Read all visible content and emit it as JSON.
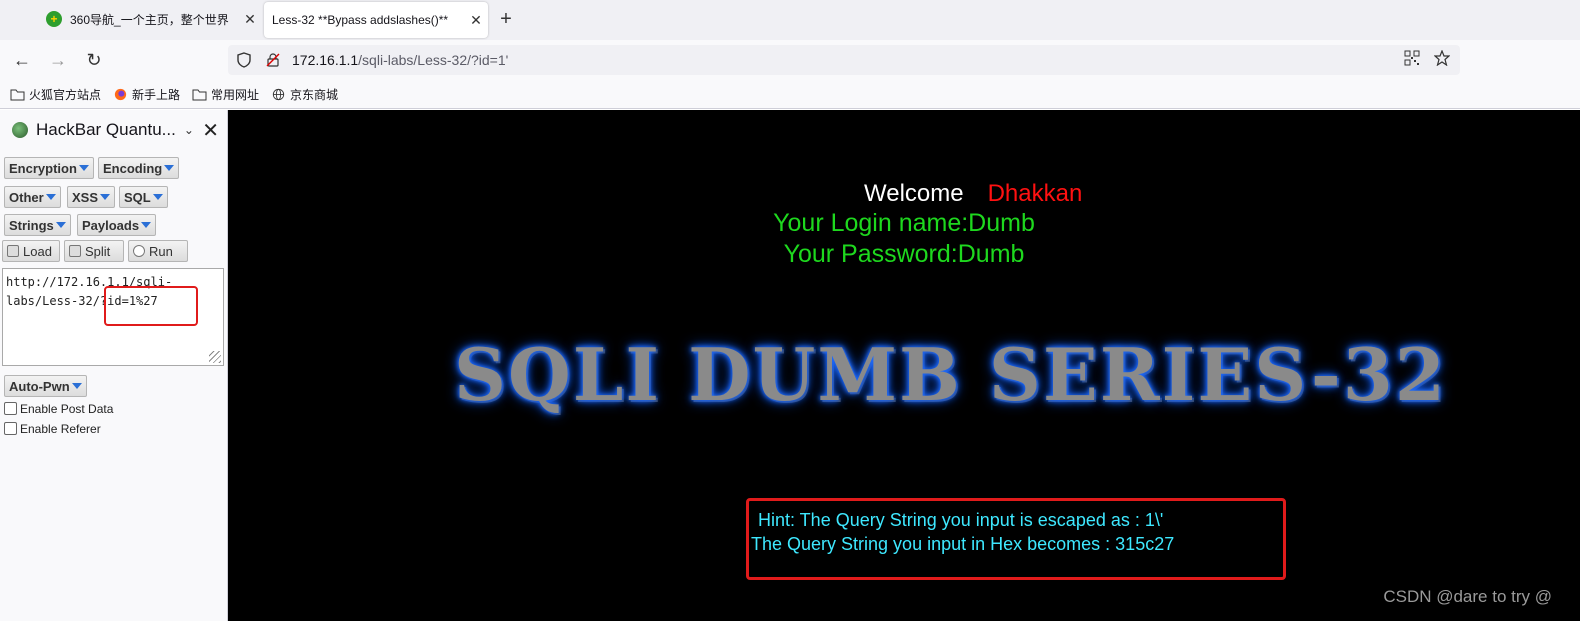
{
  "tabs": [
    {
      "title": "360导航_一个主页，整个世界",
      "active": false
    },
    {
      "title": "Less-32 **Bypass addslashes()**",
      "active": true
    }
  ],
  "nav": {
    "url_host": "172.16.1.1",
    "url_path": "/sqli-labs/Less-32/?id=1'"
  },
  "bookmarks": [
    {
      "label": "火狐官方站点",
      "icon": "folder-icon"
    },
    {
      "label": "新手上路",
      "icon": "firefox-icon"
    },
    {
      "label": "常用网址",
      "icon": "folder-icon"
    },
    {
      "label": "京东商城",
      "icon": "globe-icon"
    }
  ],
  "hackbar": {
    "title": "HackBar Quantu...",
    "menus": {
      "encryption": "Encryption",
      "encoding": "Encoding",
      "other": "Other",
      "xss": "XSS",
      "sql": "SQL",
      "strings": "Strings",
      "payloads": "Payloads",
      "autopwn": "Auto-Pwn"
    },
    "actions": {
      "load": "Load",
      "split": "Split",
      "run": "Run"
    },
    "textarea": "http://172.16.1.1/sqli-labs/Less-32/?id=1%27",
    "textarea_line1": "http://172.16.1.1/sqli-",
    "textarea_line2": "labs/Less-32/?id=1%27",
    "checkboxes": {
      "post": "Enable Post Data",
      "referer": "Enable Referer"
    }
  },
  "page": {
    "welcome": "Welcome",
    "user": "Dhakkan",
    "login_line": "Your Login name:Dumb",
    "password_line": "Your Password:Dumb",
    "banner": "SQLI DUMB SERIES-32",
    "hint1": "Hint: The Query String you input is escaped as : 1\\'",
    "hint2": "The Query String you input in Hex becomes : 315c27",
    "watermark": "CSDN @dare to try @"
  },
  "colors": {
    "welcome_green": "#1ed81e",
    "user_red": "#ff1111",
    "hint_cyan": "#3ee8ff",
    "annotation_red": "#e01b1b"
  }
}
